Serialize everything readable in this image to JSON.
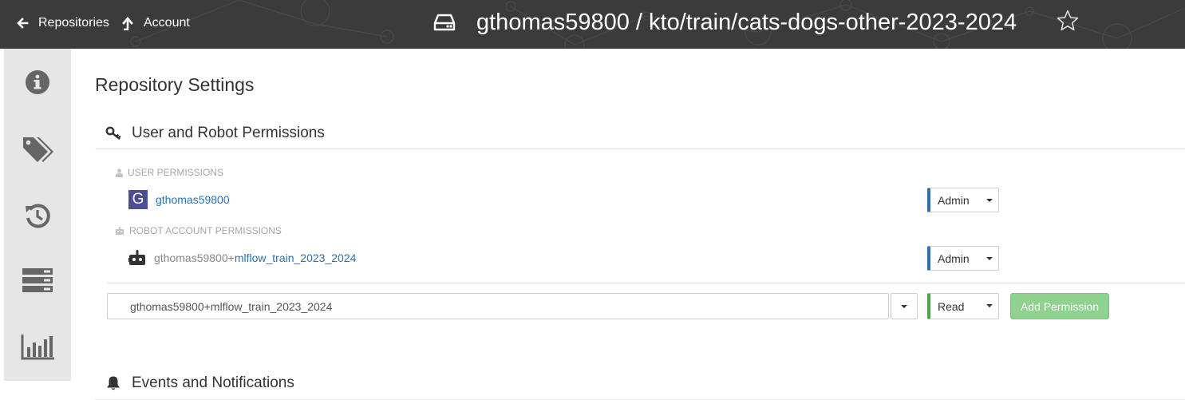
{
  "header": {
    "nav": [
      {
        "label": "Repositories",
        "icon": "arrow-left-icon"
      },
      {
        "label": "Account",
        "icon": "arrow-up-icon"
      }
    ],
    "repo_icon": "hard-drive-icon",
    "repo_path": "gthomas59800 / kto/train/cats-dogs-other-2023-2024",
    "star_icon": "star-outline-icon",
    "background_color": "#3b3b3b"
  },
  "sidebar": {
    "items": [
      {
        "name": "info",
        "icon": "info-circle-icon"
      },
      {
        "name": "tags",
        "icon": "tags-icon"
      },
      {
        "name": "history",
        "icon": "history-icon"
      },
      {
        "name": "builds",
        "icon": "server-icon"
      },
      {
        "name": "usage-logs",
        "icon": "bar-chart-icon"
      }
    ]
  },
  "main": {
    "page_title": "Repository Settings",
    "permissions_section": {
      "title": "User and Robot Permissions",
      "icon": "key-icon",
      "user_group_label": "USER PERMISSIONS",
      "robot_group_label": "ROBOT ACCOUNT PERMISSIONS",
      "users": [
        {
          "avatar_letter": "G",
          "name": "gthomas59800",
          "role": "Admin"
        }
      ],
      "robots": [
        {
          "prefix": "gthomas59800+",
          "name": "mlflow_train_2023_2024",
          "role": "Admin"
        }
      ],
      "add_form": {
        "entity_value": "gthomas59800+mlflow_train_2023_2024",
        "role": "Read",
        "button_label": "Add Permission"
      }
    },
    "events_section": {
      "title": "Events and Notifications",
      "icon": "bell-icon"
    }
  },
  "colors": {
    "admin_accent": "#2a72b5",
    "read_accent": "#47a447",
    "link": "#2a72b5",
    "add_button": "#8fd18f"
  }
}
